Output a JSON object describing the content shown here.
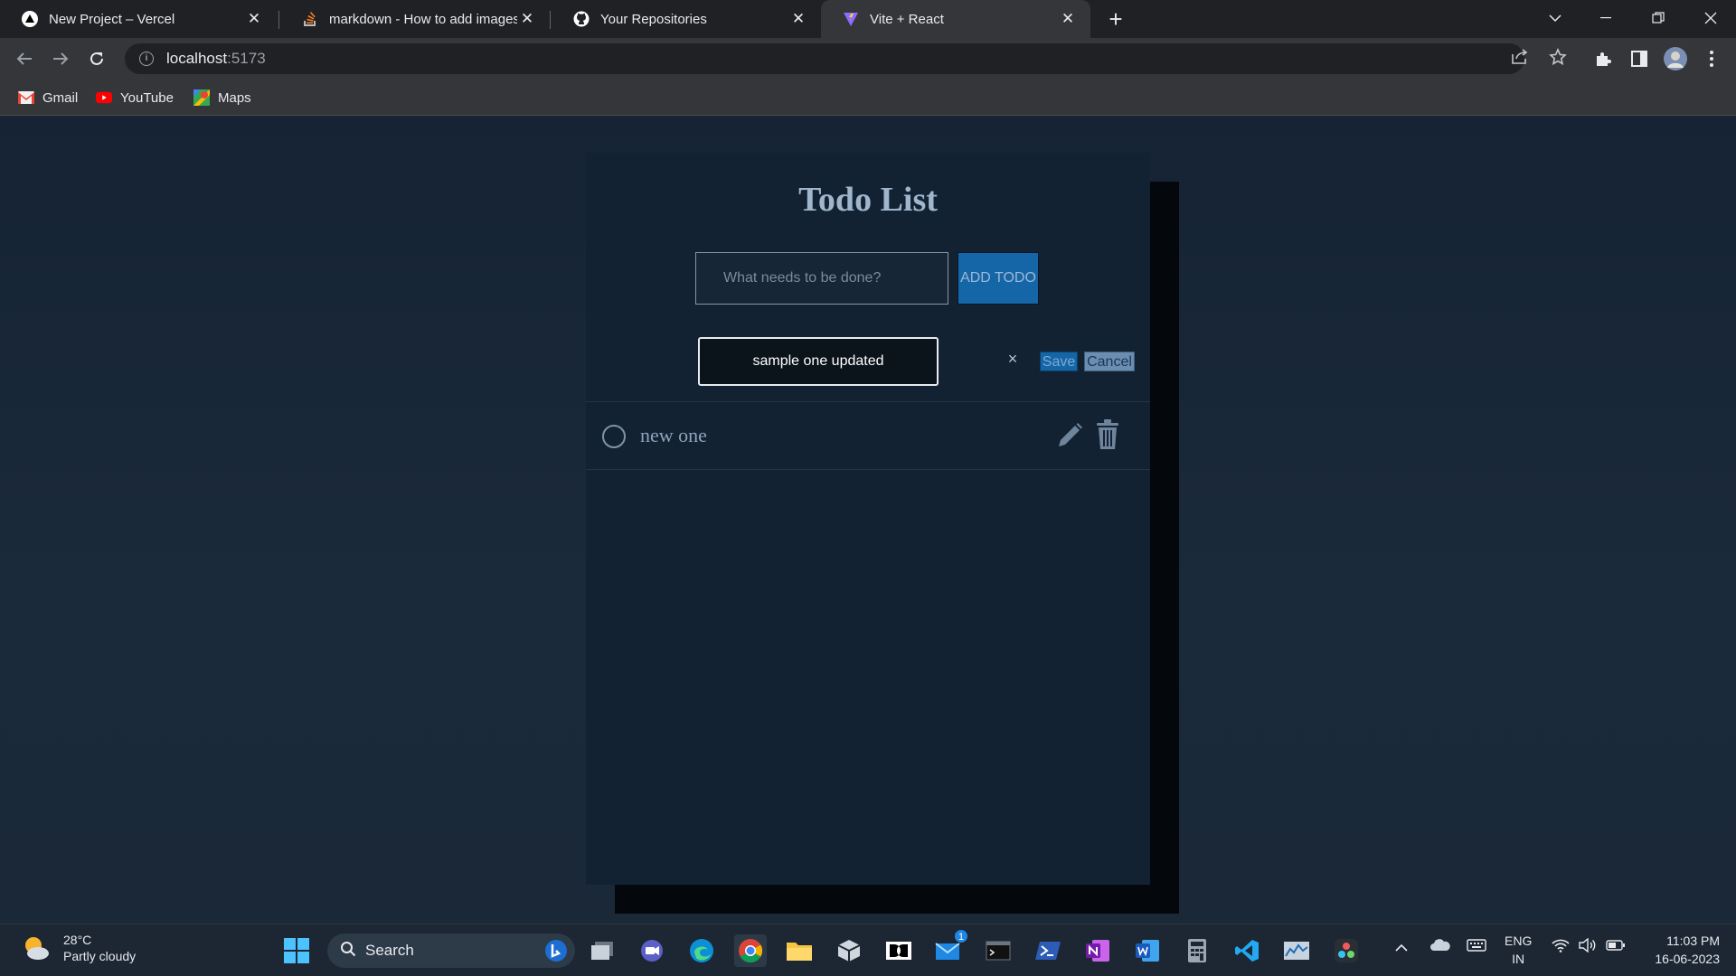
{
  "browser": {
    "tabs": [
      {
        "title": "New Project – Vercel",
        "icon": "vercel-icon",
        "active": false
      },
      {
        "title": "markdown - How to add images to R",
        "icon": "stackoverflow-icon",
        "active": false
      },
      {
        "title": "Your Repositories",
        "icon": "github-icon",
        "active": false
      },
      {
        "title": "Vite + React",
        "icon": "vite-icon",
        "active": true
      }
    ],
    "new_tab": "+",
    "url_host": "localhost",
    "url_port": ":5173",
    "bookmarks": [
      {
        "label": "Gmail",
        "icon": "gmail-icon"
      },
      {
        "label": "YouTube",
        "icon": "youtube-icon"
      },
      {
        "label": "Maps",
        "icon": "maps-icon"
      }
    ]
  },
  "app": {
    "title": "Todo List",
    "new_todo_placeholder": "What needs to be done?",
    "add_button": "ADD TODO",
    "edit_value": "sample one updated",
    "clear_symbol": "×",
    "save_button": "Save",
    "cancel_button": "Cancel",
    "todos": [
      {
        "text": "new one",
        "completed": false
      }
    ]
  },
  "taskbar": {
    "weather_temp": "28°C",
    "weather_desc": "Partly cloudy",
    "search_label": "Search",
    "mail_badge": "1",
    "lang_line1": "ENG",
    "lang_line2": "IN",
    "time": "11:03 PM",
    "date": "16-06-2023"
  },
  "colors": {
    "page_bg": "#1a2634",
    "card_bg": "#132232",
    "accent_button": "#1566a6",
    "title_text": "#9fb6cd"
  }
}
